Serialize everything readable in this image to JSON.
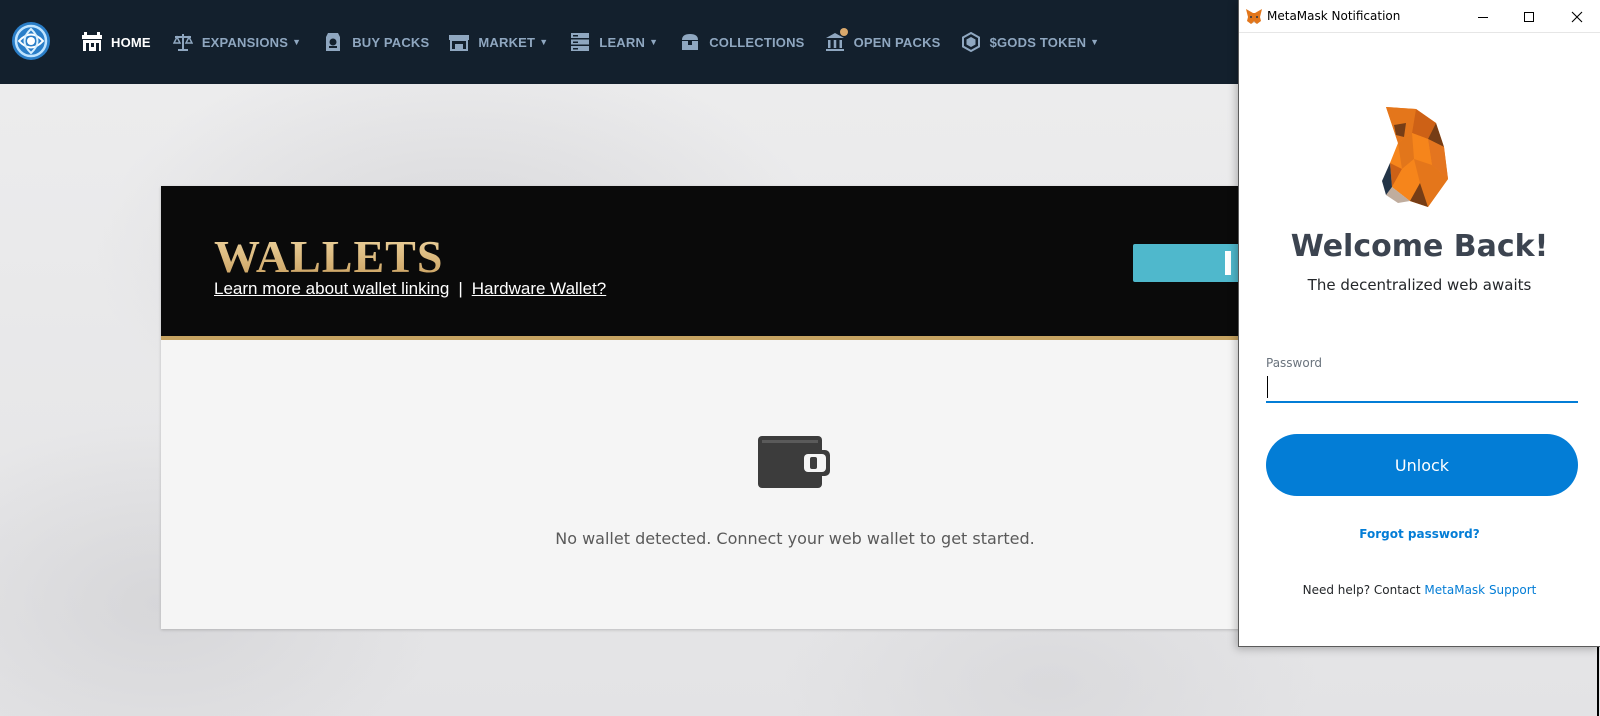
{
  "nav": {
    "items": [
      {
        "label": "HOME",
        "icon": "home-icon",
        "active": true,
        "dropdown": false
      },
      {
        "label": "EXPANSIONS",
        "icon": "scales-icon",
        "active": false,
        "dropdown": true
      },
      {
        "label": "BUY PACKS",
        "icon": "pack-icon",
        "active": false,
        "dropdown": false
      },
      {
        "label": "MARKET",
        "icon": "market-stall-icon",
        "active": false,
        "dropdown": true
      },
      {
        "label": "LEARN",
        "icon": "books-icon",
        "active": false,
        "dropdown": true
      },
      {
        "label": "COLLECTIONS",
        "icon": "chest-icon",
        "active": false,
        "dropdown": false
      },
      {
        "label": "OPEN PACKS",
        "icon": "temple-icon",
        "active": false,
        "dropdown": false,
        "notification": true
      },
      {
        "label": "$GODS TOKEN",
        "icon": "token-icon",
        "active": false,
        "dropdown": true
      }
    ],
    "caret": "▼"
  },
  "wallets": {
    "title": "WALLETS",
    "link_learn": "Learn more about wallet linking",
    "separator": "|",
    "link_hardware": "Hardware Wallet?",
    "empty_message": "No wallet detected. Connect your web wallet to get started."
  },
  "metamask": {
    "window_title": "MetaMask Notification",
    "welcome": "Welcome Back!",
    "subtitle": "The decentralized web awaits",
    "password_label": "Password",
    "password_value": "",
    "unlock_label": "Unlock",
    "forgot_label": "Forgot password?",
    "help_text": "Need help? Contact ",
    "help_link": "MetaMask Support"
  },
  "colors": {
    "nav_bg": "#13202d",
    "nav_text": "#8fa7c0",
    "gold": "#c6a361",
    "connect_teal": "#4fb8cc",
    "metamask_blue": "#037dd6"
  }
}
